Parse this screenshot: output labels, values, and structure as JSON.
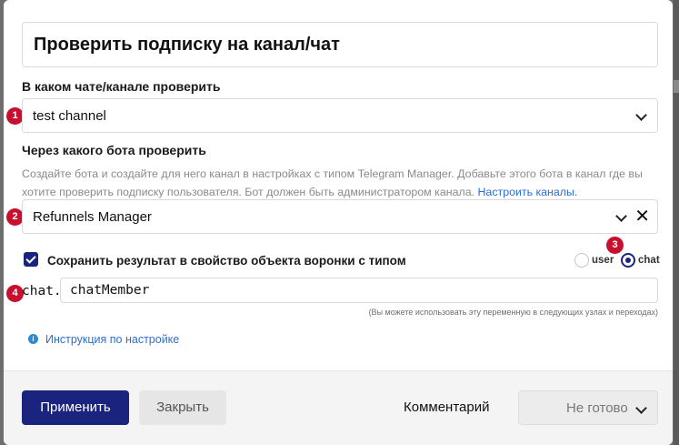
{
  "dialog": {
    "title": "Проверить подписку на канал/чат",
    "chat_label": "В каком чате/канале проверить",
    "chat_value": "test channel",
    "bot_label": "Через какого бота проверить",
    "bot_hint": "Создайте бота и создайте для него канал в настройках с типом Telegram Manager. Добавьте этого бота в канал где вы хотите проверить подписку пользователя. Бот должен быть администратором канала.",
    "bot_hint_link": "Настроить каналы.",
    "bot_value": "Refunnels Manager",
    "save_checkbox_label": "Сохранить результат в свойство объекта воронки с типом",
    "save_checked": true,
    "radio_user_label": "user",
    "radio_chat_label": "chat",
    "radio_selected": "chat",
    "var_prefix": "chat.",
    "var_value": "chatMember",
    "var_note": "(Вы можете использовать эту переменную в следующих узлах и переходах)",
    "info_link": "Инструкция по настройке"
  },
  "badges": [
    "1",
    "2",
    "3",
    "4"
  ],
  "footer": {
    "apply_label": "Применить",
    "close_label": "Закрыть",
    "comment_label": "Комментарий",
    "status_value": "Не готово"
  },
  "colors": {
    "primary": "#1a237e",
    "badge": "#c8102e",
    "link": "#2b6fd6"
  },
  "icons": [
    "chevron-down-icon",
    "close-icon",
    "info-icon",
    "check-icon"
  ]
}
